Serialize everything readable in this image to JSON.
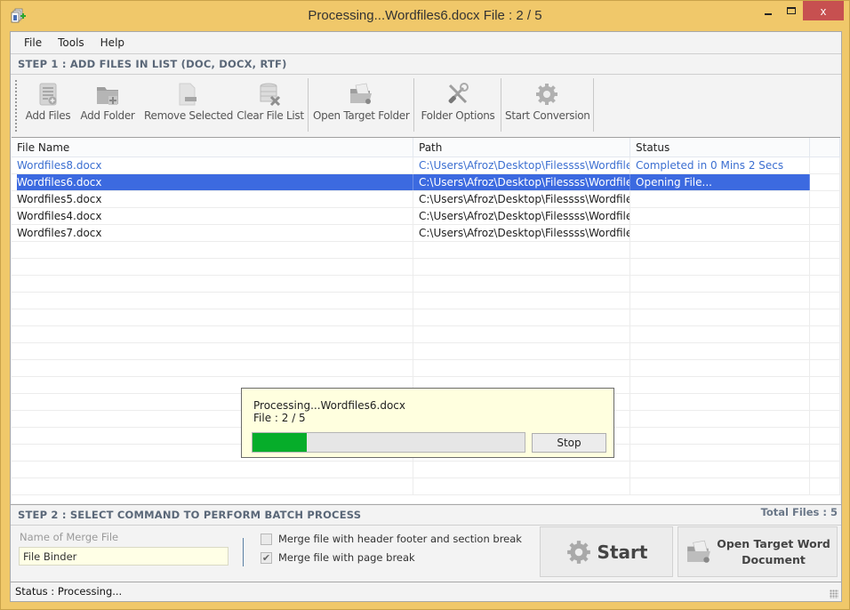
{
  "window": {
    "title": "Processing...Wordfiles6.docx File : 2 / 5",
    "close_glyph": "x"
  },
  "menu": [
    "File",
    "Tools",
    "Help"
  ],
  "step1": {
    "header": "STEP 1 : ADD FILES IN LIST (DOC, DOCX, RTF)"
  },
  "toolbar": {
    "add_files": "Add Files",
    "add_folder": "Add Folder",
    "remove_selected": "Remove Selected",
    "clear_file_list": "Clear File List",
    "open_target_folder": "Open Target Folder",
    "folder_options": "Folder Options",
    "start_conversion": "Start Conversion"
  },
  "grid": {
    "columns": [
      "File Name",
      "Path",
      "Status"
    ],
    "rows": [
      {
        "name": "Wordfiles8.docx",
        "path": "C:\\Users\\Afroz\\Desktop\\Filessss\\Wordfiles...",
        "status": "Completed in 0 Mins 2 Secs",
        "state": "done"
      },
      {
        "name": "Wordfiles6.docx",
        "path": "C:\\Users\\Afroz\\Desktop\\Filessss\\Wordfiles...",
        "status": "Opening File...",
        "state": "selected"
      },
      {
        "name": "Wordfiles5.docx",
        "path": "C:\\Users\\Afroz\\Desktop\\Filessss\\Wordfiles...",
        "status": "",
        "state": "pending"
      },
      {
        "name": "Wordfiles4.docx",
        "path": "C:\\Users\\Afroz\\Desktop\\Filessss\\Wordfiles...",
        "status": "",
        "state": "pending"
      },
      {
        "name": "Wordfiles7.docx",
        "path": "C:\\Users\\Afroz\\Desktop\\Filessss\\Wordfiles...",
        "status": "",
        "state": "pending"
      }
    ]
  },
  "progress": {
    "line1": "Processing...Wordfiles6.docx",
    "line2": "File : 2 / 5",
    "percent": 20,
    "stop_label": "Stop",
    "fill_color": "#06ad2a"
  },
  "step2": {
    "header": "STEP 2 : SELECT COMMAND TO PERFORM BATCH PROCESS",
    "total_files": "Total Files : 5",
    "merge_label": "Name of Merge File",
    "merge_value": "File Binder",
    "option1": {
      "label": "Merge file with header footer and section break",
      "checked": false
    },
    "option2": {
      "label": "Merge file with page break",
      "checked": true
    },
    "start_label": "Start",
    "open_target_line1": "Open Target Word",
    "open_target_line2": "Document"
  },
  "status": {
    "text": "Status  :  Processing..."
  },
  "colors": {
    "frame": "#f0c86a",
    "selection": "#3c6ae0",
    "completed_text": "#3c6fd1",
    "close_button": "#c75050"
  }
}
